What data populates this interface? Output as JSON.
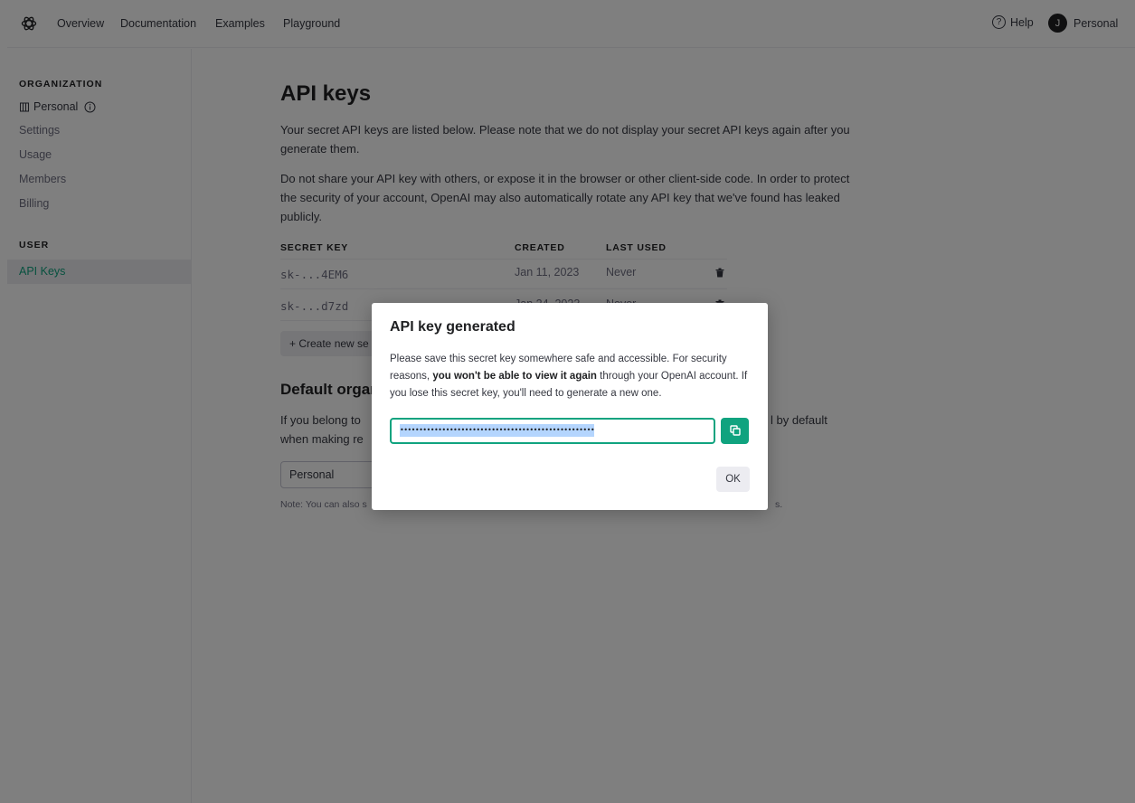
{
  "nav": {
    "links": [
      "Overview",
      "Documentation",
      "Examples",
      "Playground"
    ],
    "help_icon": "?",
    "help": "Help",
    "avatar_initial": "J",
    "user": "Personal"
  },
  "sidebar": {
    "org_heading": "ORGANIZATION",
    "org_name": "Personal",
    "org_items": [
      "Settings",
      "Usage",
      "Members",
      "Billing"
    ],
    "user_heading": "USER",
    "active_item": "API Keys"
  },
  "main": {
    "title": "API keys",
    "para1": "Your secret API keys are listed below. Please note that we do not display your secret API keys again after you generate them.",
    "para2": "Do not share your API key with others, or expose it in the browser or other client-side code. In order to protect the security of your account, OpenAI may also automatically rotate any API key that we've found has leaked publicly.",
    "table": {
      "headers": [
        "SECRET KEY",
        "CREATED",
        "LAST USED"
      ],
      "rows": [
        {
          "key": "sk-...4EM6",
          "created": "Jan 11, 2023",
          "last_used": "Never"
        },
        {
          "key": "sk-...d7zd",
          "created": "Jan 24, 2023",
          "last_used": "Never"
        }
      ]
    },
    "create_button": "+ Create new se",
    "default_org_heading": "Default orgar",
    "default_org_line1": "If you belong to",
    "default_org_line1_tail": "l by default",
    "default_org_line2": "when making re",
    "select_value": "Personal",
    "note": "Note: You can also s",
    "note_tail": "s."
  },
  "modal": {
    "title": "API key generated",
    "body_1": "Please save this secret key somewhere safe and accessible. For security reasons, ",
    "body_bold": "you won't be able to view it again",
    "body_2": " through your OpenAI account. If you lose this secret key, you'll need to generate a new one.",
    "key_value": "•••••••••••••••••••••••••••••••••••••••••••••••••••",
    "ok_label": "OK"
  },
  "colors": {
    "accent": "#10a37f",
    "overlay": "rgba(0,0,0,0.5)",
    "selection": "#b4d5fe"
  }
}
